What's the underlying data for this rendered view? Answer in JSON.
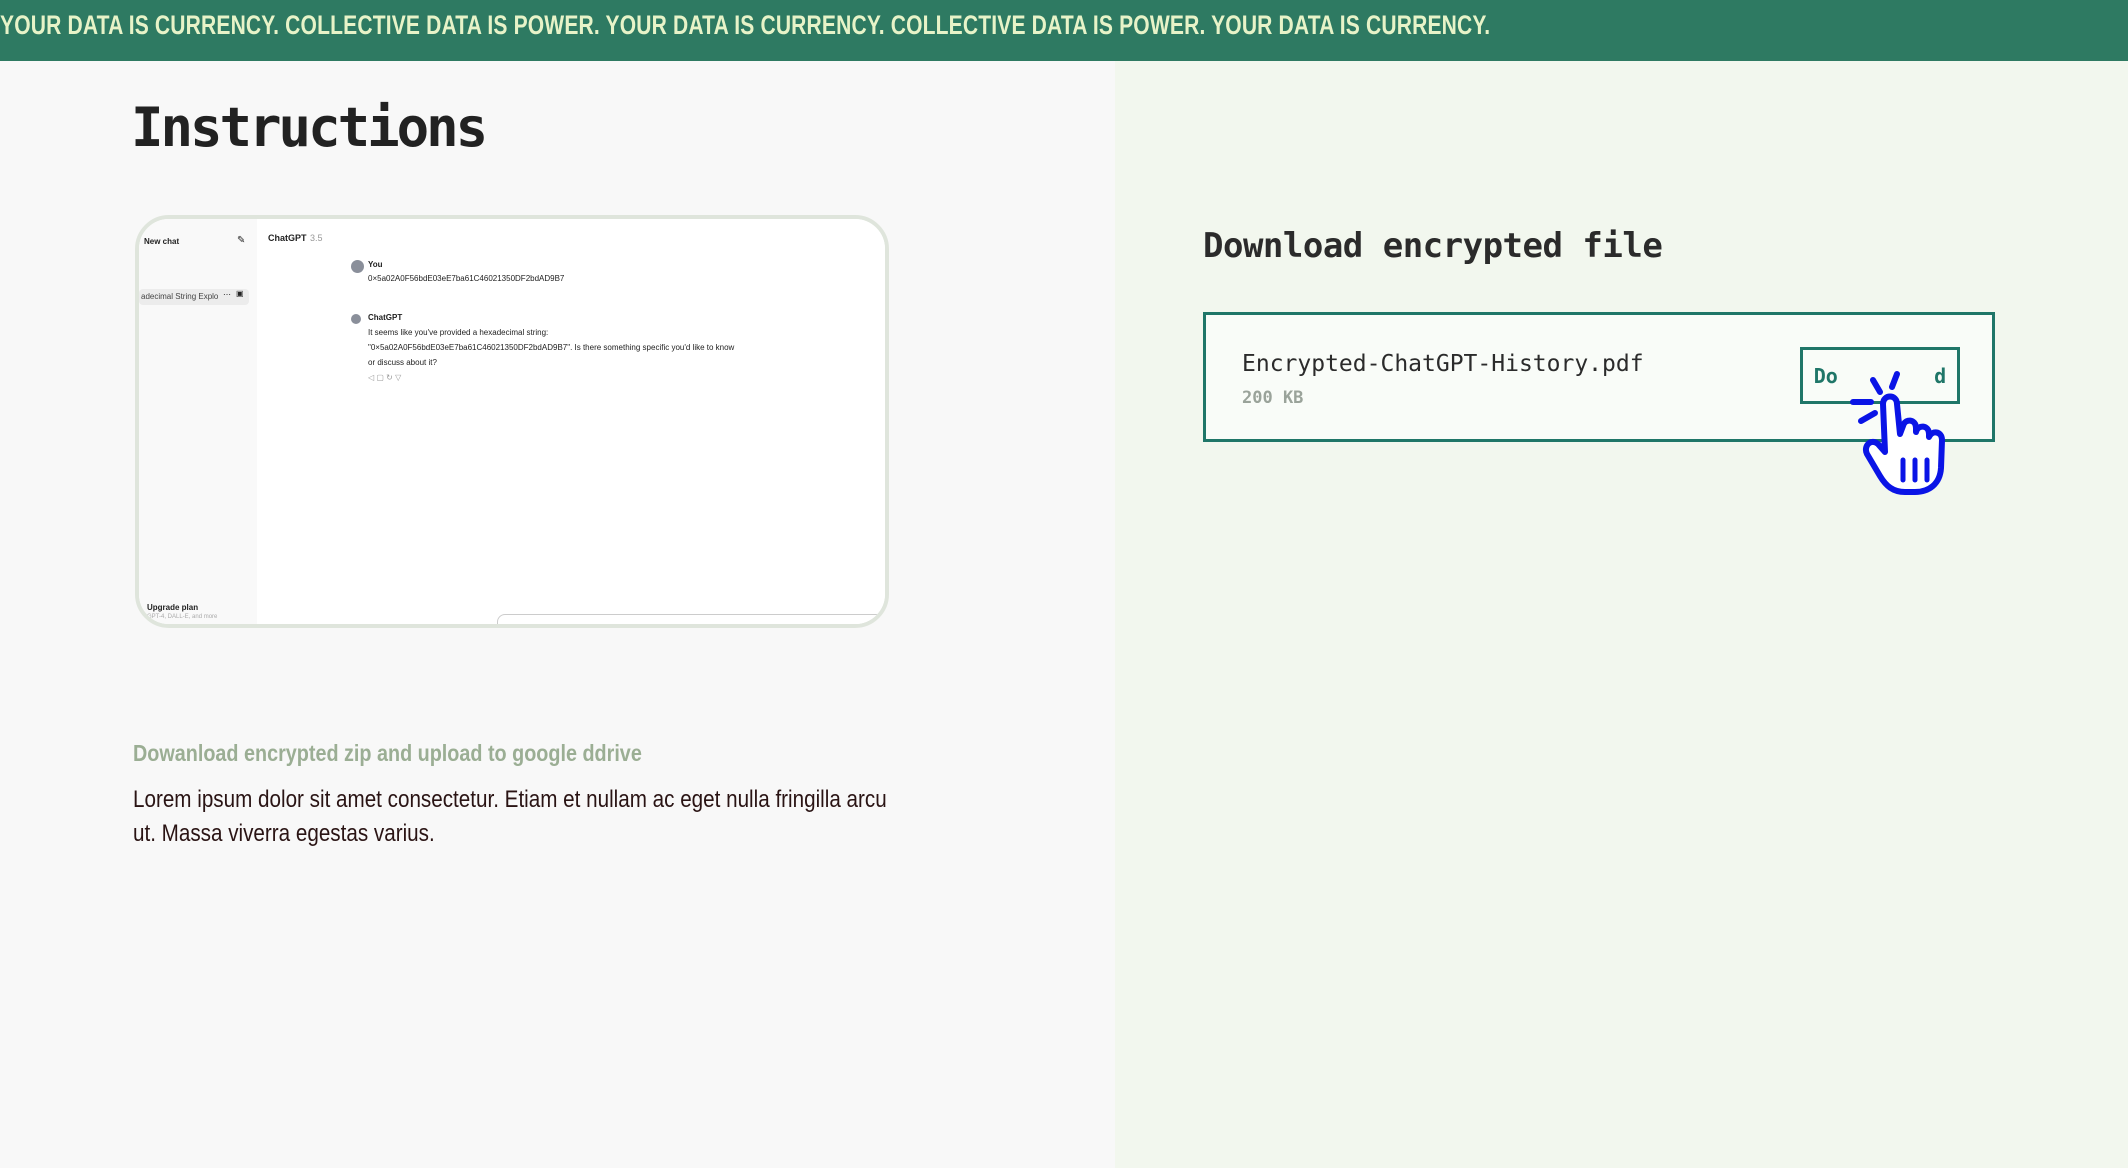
{
  "ticker": {
    "text": "YOUR DATA IS CURRENCY. COLLECTIVE DATA IS POWER. YOUR DATA IS CURRENCY. COLLECTIVE DATA IS POWER. YOUR DATA IS CURRENCY."
  },
  "instructions": {
    "heading": "Instructions",
    "screenshot": {
      "sidebar_new_chat": "New chat",
      "sidebar_item": "adecimal String Explo",
      "sidebar_upgrade": "Upgrade plan",
      "sidebar_upgrade_sub": "GPT-4, DALL-E, and more",
      "model_name": "ChatGPT",
      "model_version": "3.5",
      "user_name": "You",
      "user_message": "0×5a02A0F56bdE03eE7ba61C46021350DF2bdAD9B7",
      "bot_name": "ChatGPT",
      "bot_line1": "It seems like you've provided a hexadecimal string:",
      "bot_line2": "\"0×5a02A0F56bdE03eE7ba61C46021350DF2bdAD9B7\". Is there something specific you'd like to know",
      "bot_line3": "or discuss about it?"
    },
    "step_title": "Dowanload encrypted zip and upload to google ddrive",
    "step_body": "Lorem ipsum dolor sit amet consectetur. Etiam et nullam ac eget nulla fringilla arcu ut. Massa viverra egestas varius."
  },
  "download": {
    "heading": "Download encrypted file",
    "file_name": "Encrypted-ChatGPT-History.pdf",
    "file_size": "200 KB",
    "button_label": "Do        d"
  },
  "colors": {
    "ticker_bg": "#2e7a62",
    "ticker_text": "#e7f3c8",
    "accent": "#1f7668",
    "cursor": "#0a14e6"
  }
}
